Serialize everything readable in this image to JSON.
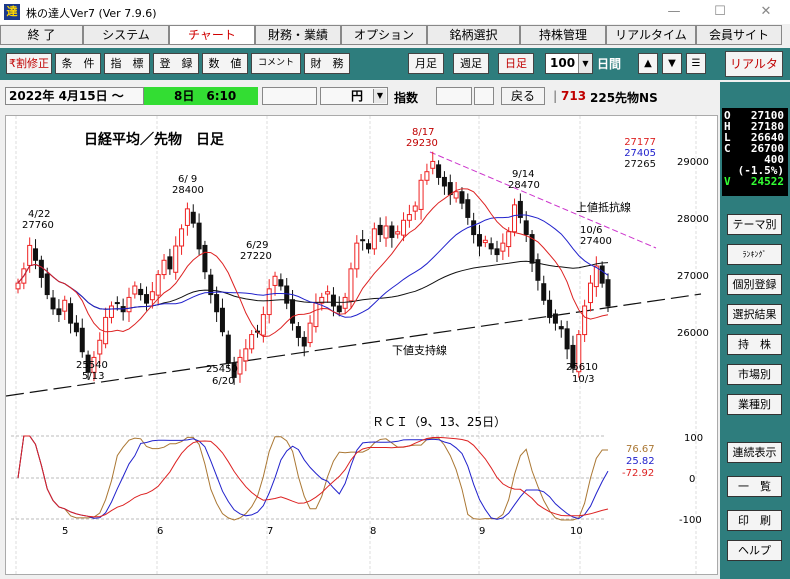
{
  "titlebar": {
    "title": "株の達人Ver7 (Ver 7.9.6)",
    "icon_char": "達"
  },
  "menu": [
    "終 了",
    "システム",
    "チャート",
    "財務・業績",
    "オプション",
    "銘柄選択",
    "持株管理",
    "リアルタイム",
    "会員サイト"
  ],
  "menu_active": 2,
  "toolbar": {
    "left_buttons": [
      "₹割修正",
      "条　件",
      "指　標",
      "登　録",
      "数　値",
      "コメント",
      "財　務"
    ],
    "period_buttons": [
      "月足",
      "週足",
      "日足"
    ],
    "active_period": "日足",
    "days_value": "100",
    "days_label": "日間",
    "realtime": "リアルタイム"
  },
  "infobar": {
    "date": "2022年 4月15日 ～",
    "green_time": "8日　6:10",
    "currency": "円",
    "index_label": "指数",
    "back": "戻る",
    "code": "713",
    "code_name": "225先物NS"
  },
  "quote": {
    "O": "27100",
    "H": "27180",
    "L": "26640",
    "C": "26700",
    "change": "400",
    "change_pct": "(-1.5%)",
    "V": "24522"
  },
  "side_buttons": [
    "テーマ別",
    "ﾗﾝｷﾝｸﾞ",
    "個別登録",
    "選択結果",
    "持　株",
    "市場別",
    "業種別",
    "連続表示",
    "一　覧",
    "印　刷",
    "ヘルプ"
  ],
  "colors": {
    "teal": "#2e7d7d",
    "candle_up": "#ee2222",
    "candle_down": "#111111",
    "ma_short": "#dd2222",
    "ma_mid": "#2222cc",
    "ma_long": "#111111",
    "resistance": "#cc33cc"
  },
  "chart_data": [
    {
      "type": "candlestick",
      "title": "日経平均／先物　日足",
      "y_ticks": [
        "29000",
        "28000",
        "27000",
        "26000"
      ],
      "ylim": [
        25300,
        29500
      ],
      "x_ticks": [
        "5",
        "6",
        "7",
        "8",
        "9",
        "10"
      ],
      "ma_values": [
        {
          "value": "27177",
          "color": "#dd2222"
        },
        {
          "value": "27405",
          "color": "#2222cc"
        },
        {
          "value": "27265",
          "color": "#111111"
        }
      ],
      "annotations": [
        {
          "date": "4/22",
          "price": "27760"
        },
        {
          "date": "6/ 9",
          "price": "28400"
        },
        {
          "date": "6/29",
          "price": "27220"
        },
        {
          "date": "8/17",
          "price": "29230"
        },
        {
          "date": "9/14",
          "price": "28470"
        },
        {
          "date": "10/6",
          "price": "27400"
        },
        {
          "date": "5/13",
          "price": "25540"
        },
        {
          "date": "6/20",
          "price": "25450"
        },
        {
          "date": "10/3",
          "price": "25610"
        }
      ],
      "upper_resistance_label": "上値抵抗線",
      "lower_support_label": "下値支持線",
      "closes": [
        27100,
        27350,
        27760,
        27500,
        27200,
        26900,
        26650,
        26550,
        26800,
        26400,
        26250,
        25900,
        25540,
        25800,
        26100,
        26500,
        26700,
        26750,
        26600,
        26850,
        27050,
        26900,
        26750,
        26950,
        27250,
        27500,
        27350,
        27750,
        28050,
        28400,
        28150,
        27700,
        27300,
        26900,
        26600,
        26250,
        25700,
        25450,
        25800,
        25950,
        26200,
        26250,
        26550,
        27000,
        27220,
        27050,
        26750,
        26400,
        26150,
        26000,
        26400,
        26750,
        26850,
        26950,
        26700,
        26600,
        26850,
        27350,
        27800,
        27850,
        27700,
        28050,
        27950,
        28100,
        27900,
        28000,
        28200,
        28300,
        28450,
        28900,
        29050,
        29230,
        28950,
        28800,
        28650,
        28700,
        28500,
        28250,
        27950,
        27750,
        27850,
        27700,
        27600,
        27800,
        28000,
        28470,
        28250,
        27950,
        27450,
        27150,
        26800,
        26500,
        26400,
        26300,
        25950,
        25610,
        26200,
        26700,
        27100,
        27400,
        27100,
        26700
      ],
      "rci": {
        "title": "ＲＣＩ（9、13、25日）",
        "y_ticks": [
          "100",
          "0",
          "-100"
        ],
        "series": [
          {
            "name": "9",
            "value": "76.67",
            "color": "#aa7733"
          },
          {
            "name": "13",
            "value": "25.82",
            "color": "#2222cc"
          },
          {
            "name": "25",
            "value": "-72.92",
            "color": "#dd2222"
          }
        ]
      }
    }
  ]
}
